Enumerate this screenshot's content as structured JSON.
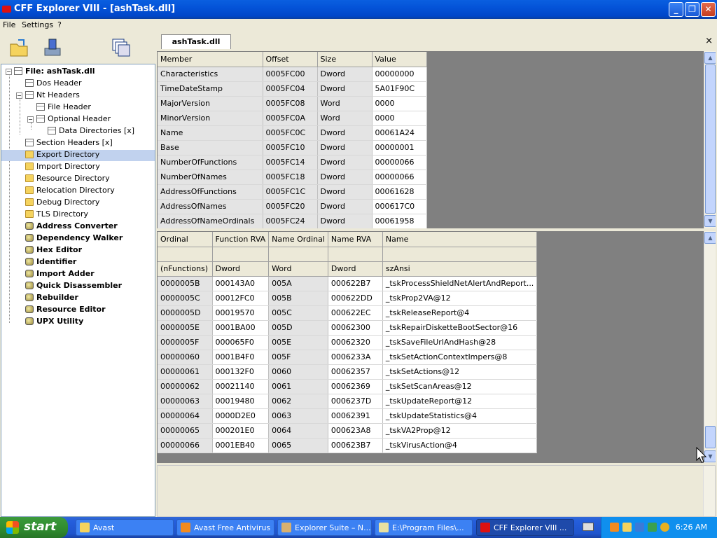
{
  "window": {
    "title": "CFF Explorer VIII - [ashTask.dll]"
  },
  "menu": [
    "File",
    "Settings",
    "?"
  ],
  "tab": {
    "label": "ashTask.dll",
    "close": "×"
  },
  "tree": {
    "root": "File: ashTask.dll",
    "items": [
      {
        "label": "Dos Header",
        "icon": "doc"
      },
      {
        "label": "Nt Headers",
        "icon": "doc"
      },
      {
        "label": "File Header",
        "icon": "doc"
      },
      {
        "label": "Optional Header",
        "icon": "doc"
      },
      {
        "label": "Data Directories [x]",
        "icon": "doc"
      },
      {
        "label": "Section Headers [x]",
        "icon": "doc"
      },
      {
        "label": "Export Directory",
        "icon": "folder"
      },
      {
        "label": "Import Directory",
        "icon": "folder"
      },
      {
        "label": "Resource Directory",
        "icon": "folder"
      },
      {
        "label": "Relocation Directory",
        "icon": "folder"
      },
      {
        "label": "Debug Directory",
        "icon": "folder"
      },
      {
        "label": "TLS Directory",
        "icon": "folder"
      },
      {
        "label": "Address Converter",
        "icon": "tool"
      },
      {
        "label": "Dependency Walker",
        "icon": "tool"
      },
      {
        "label": "Hex Editor",
        "icon": "tool"
      },
      {
        "label": "Identifier",
        "icon": "tool"
      },
      {
        "label": "Import Adder",
        "icon": "tool"
      },
      {
        "label": "Quick Disassembler",
        "icon": "tool"
      },
      {
        "label": "Rebuilder",
        "icon": "tool"
      },
      {
        "label": "Resource Editor",
        "icon": "tool"
      },
      {
        "label": "UPX Utility",
        "icon": "tool"
      }
    ]
  },
  "export_table": {
    "headers": [
      "Member",
      "Offset",
      "Size",
      "Value"
    ],
    "rows": [
      [
        "Characteristics",
        "0005FC00",
        "Dword",
        "00000000"
      ],
      [
        "TimeDateStamp",
        "0005FC04",
        "Dword",
        "5A01F90C"
      ],
      [
        "MajorVersion",
        "0005FC08",
        "Word",
        "0000"
      ],
      [
        "MinorVersion",
        "0005FC0A",
        "Word",
        "0000"
      ],
      [
        "Name",
        "0005FC0C",
        "Dword",
        "00061A24"
      ],
      [
        "Base",
        "0005FC10",
        "Dword",
        "00000001"
      ],
      [
        "NumberOfFunctions",
        "0005FC14",
        "Dword",
        "00000066"
      ],
      [
        "NumberOfNames",
        "0005FC18",
        "Dword",
        "00000066"
      ],
      [
        "AddressOfFunctions",
        "0005FC1C",
        "Dword",
        "00061628"
      ],
      [
        "AddressOfNames",
        "0005FC20",
        "Dword",
        "000617C0"
      ],
      [
        "AddressOfNameOrdinals",
        "0005FC24",
        "Dword",
        "00061958"
      ]
    ]
  },
  "functions_table": {
    "headers": [
      "Ordinal",
      "Function RVA",
      "Name Ordinal",
      "Name RVA",
      "Name"
    ],
    "subheader": [
      "(nFunctions)",
      "Dword",
      "Word",
      "Dword",
      "szAnsi"
    ],
    "rows": [
      [
        "0000005B",
        "000143A0",
        "005A",
        "000622B7",
        "_tskProcessShieldNetAlertAndReport..."
      ],
      [
        "0000005C",
        "00012FC0",
        "005B",
        "000622DD",
        "_tskProp2VA@12"
      ],
      [
        "0000005D",
        "00019570",
        "005C",
        "000622EC",
        "_tskReleaseReport@4"
      ],
      [
        "0000005E",
        "0001BA00",
        "005D",
        "00062300",
        "_tskRepairDisketteBootSector@16"
      ],
      [
        "0000005F",
        "000065F0",
        "005E",
        "00062320",
        "_tskSaveFileUrlAndHash@28"
      ],
      [
        "00000060",
        "0001B4F0",
        "005F",
        "0006233A",
        "_tskSetActionContextImpers@8"
      ],
      [
        "00000061",
        "000132F0",
        "0060",
        "00062357",
        "_tskSetActions@12"
      ],
      [
        "00000062",
        "00021140",
        "0061",
        "00062369",
        "_tskSetScanAreas@12"
      ],
      [
        "00000063",
        "00019480",
        "0062",
        "0006237D",
        "_tskUpdateReport@12"
      ],
      [
        "00000064",
        "0000D2E0",
        "0063",
        "00062391",
        "_tskUpdateStatistics@4"
      ],
      [
        "00000065",
        "000201E0",
        "0064",
        "000623A8",
        "_tskVA2Prop@12"
      ],
      [
        "00000066",
        "0001EB40",
        "0065",
        "000623B7",
        "_tskVirusAction@4"
      ]
    ]
  },
  "taskbar": {
    "start": "start",
    "tasks": [
      "Avast",
      "Avast Free Antivirus",
      "Explorer Suite – N...",
      "E:\\Program Files\\...",
      "CFF Explorer VIII ..."
    ],
    "clock": "6:26 AM"
  },
  "colors": {
    "selection": "#C1D2EE",
    "taskbar": "#245EDC",
    "start": "#2f8a2f"
  }
}
